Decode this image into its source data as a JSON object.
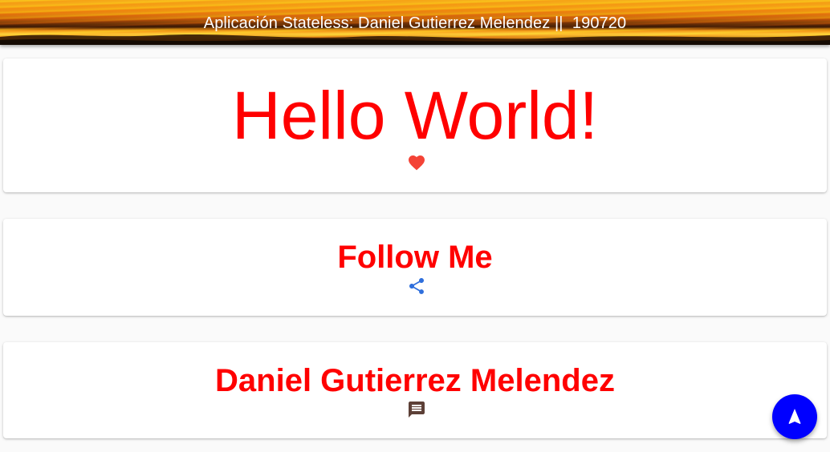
{
  "appbar": {
    "title": "Aplicación Stateless: Daniel Gutierrez Melendez ||  190720"
  },
  "cards": [
    {
      "text": "Hello World!",
      "icon": "heart-icon",
      "icon_color": "#f44336",
      "text_color": "#ff0000"
    },
    {
      "text": "Follow Me",
      "icon": "share-icon",
      "icon_color": "#2f6fdc",
      "text_color": "#ff0000"
    },
    {
      "text": "Daniel Gutierrez Melendez",
      "icon": "comment-icon",
      "icon_color": "#5d4037",
      "text_color": "#ff0000"
    }
  ],
  "fab": {
    "icon": "navigation-arrow-icon",
    "color": "#0000ff"
  }
}
